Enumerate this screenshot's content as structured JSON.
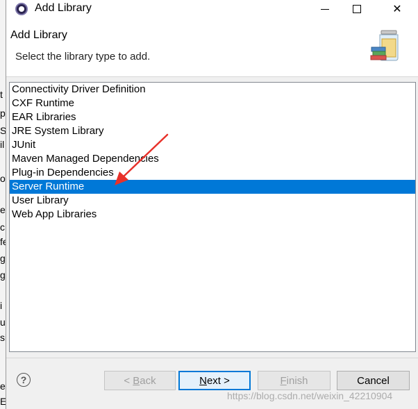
{
  "window": {
    "title": "Add Library",
    "minimize_label": "—",
    "maximize_label": "☐",
    "close_label": "✕"
  },
  "header": {
    "title": "Add Library",
    "description": "Select the library type to add."
  },
  "library_types": [
    "Connectivity Driver Definition",
    "CXF Runtime",
    "EAR Libraries",
    "JRE System Library",
    "JUnit",
    "Maven Managed Dependencies",
    "Plug-in Dependencies",
    "Server Runtime",
    "User Library",
    "Web App Libraries"
  ],
  "selected_library": "Server Runtime",
  "buttons": {
    "help": "?",
    "back": {
      "prefix": "< ",
      "mnemonic": "B",
      "rest": "ack"
    },
    "next": {
      "mnemonic": "N",
      "rest": "ext >"
    },
    "finish": {
      "mnemonic": "F",
      "rest": "inish"
    },
    "cancel": "Cancel"
  },
  "background_fragments": [
    "t",
    "p",
    "S",
    "il",
    "o",
    "er",
    "c",
    "fe",
    "g",
    "g",
    "i",
    "u",
    "si",
    "er",
    "Eu"
  ],
  "watermark": "https://blog.csdn.net/weixin_42210904",
  "colors": {
    "selection": "#0078d7",
    "annotation_arrow": "#e8312a"
  },
  "icons": {
    "app": "eclipse-icon",
    "header": "library-jar-icon",
    "help": "help-icon"
  }
}
